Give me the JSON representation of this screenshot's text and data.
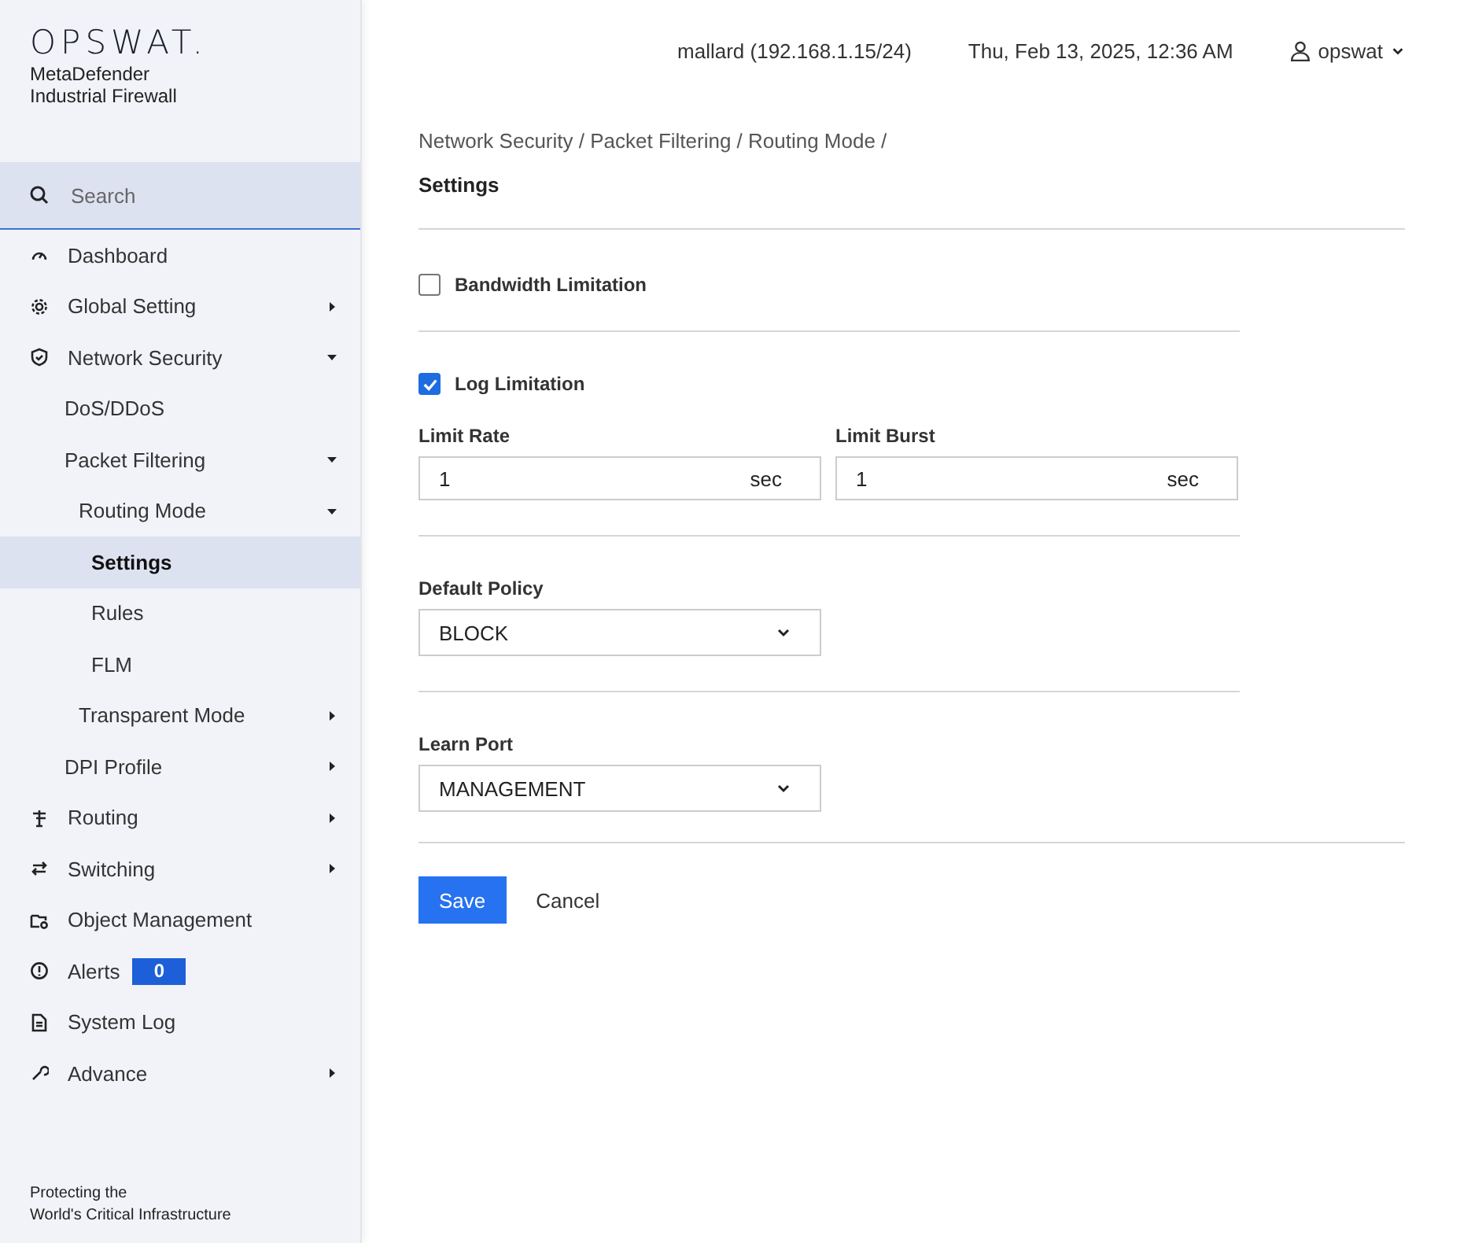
{
  "sidebar": {
    "logo": "OPSWAT.",
    "product": [
      "MetaDefender",
      "Industrial Firewall"
    ],
    "search": {
      "placeholder": "Search"
    },
    "items": [
      {
        "label": "Dashboard",
        "selected": false
      },
      {
        "label": "Global Setting",
        "selected": false,
        "expanded": false
      },
      {
        "label": "Network Security",
        "selected": false,
        "expanded": true,
        "children": [
          {
            "label": "DoS/DDoS",
            "selected": false
          },
          {
            "label": "Packet Filtering",
            "selected": false,
            "expanded": true,
            "children": [
              {
                "label": "Routing Mode",
                "selected": false,
                "expanded": true,
                "children": [
                  {
                    "label": "Settings",
                    "selected": true
                  },
                  {
                    "label": "Rules",
                    "selected": false
                  },
                  {
                    "label": "FLM",
                    "selected": false
                  }
                ]
              },
              {
                "label": "Transparent Mode",
                "selected": false,
                "expanded": false
              }
            ]
          },
          {
            "label": "DPI Profile",
            "selected": false,
            "expanded": false
          }
        ]
      },
      {
        "label": "Routing",
        "selected": false,
        "expanded": false
      },
      {
        "label": "Switching",
        "selected": false,
        "expanded": false
      },
      {
        "label": "Object Management",
        "selected": false
      },
      {
        "label": "Alerts",
        "selected": false,
        "badge": "0"
      },
      {
        "label": "System Log",
        "selected": false
      },
      {
        "label": "Advance",
        "selected": false,
        "expanded": false
      }
    ],
    "footer": [
      "Protecting the",
      "World's Critical Infrastructure"
    ]
  },
  "header": {
    "host": "mallard (192.168.1.15/24)",
    "datetime": "Thu, Feb 13, 2025, 12:36 AM",
    "user": "opswat"
  },
  "breadcrumb": "Network Security / Packet Filtering / Routing Mode /",
  "title": "Settings",
  "bandwidth": {
    "label": "Bandwidth Limitation",
    "checked": false
  },
  "log": {
    "label": "Log Limitation",
    "checked": true,
    "fields": [
      {
        "label": "Limit Rate",
        "value": "1",
        "unit": "sec"
      },
      {
        "label": "Limit Burst",
        "value": "1",
        "unit": "sec"
      }
    ]
  },
  "default_policy": {
    "label": "Default Policy",
    "value": "BLOCK"
  },
  "learn_port": {
    "label": "Learn Port",
    "value": "MANAGEMENT"
  },
  "buttons": [
    {
      "label": "Save",
      "kind": "primary"
    },
    {
      "label": "Cancel",
      "kind": "plain"
    }
  ]
}
